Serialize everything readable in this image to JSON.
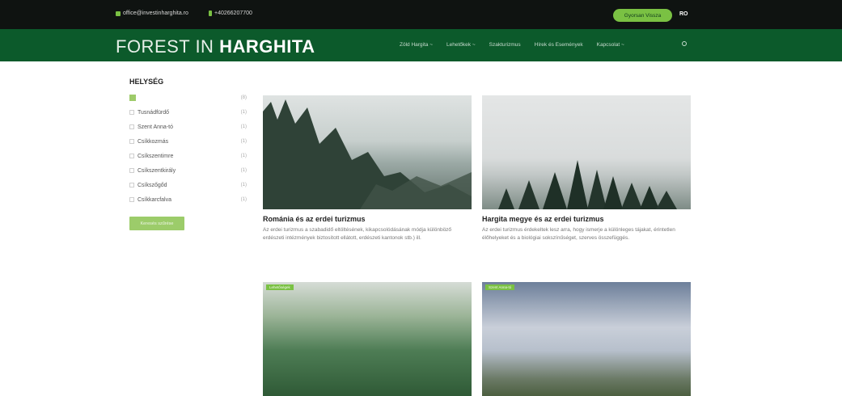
{
  "topbar": {
    "email": "office@investinharghita.ro",
    "phone": "+40266207700",
    "cta_label": "Gyorsan Vissza",
    "lang": "RO"
  },
  "nav": {
    "logo_part1": "FOREST IN ",
    "logo_part2": "HARGHITA",
    "items": [
      "Zöld Hargita ~",
      "Lehetőkek ~",
      "Szakturizmus",
      "Hírek és Események",
      "Kapcsolat ~"
    ],
    "search_icon": "search-icon"
  },
  "sidebar": {
    "title": "HELYSÉG",
    "all_count": "(8)",
    "filters": [
      {
        "label": "Tusnádfürdő",
        "count": "(1)"
      },
      {
        "label": "Szent Anna-tó",
        "count": "(1)"
      },
      {
        "label": "Csíkkozmás",
        "count": "(1)"
      },
      {
        "label": "Csíkszentimre",
        "count": "(1)"
      },
      {
        "label": "Csíkszentkirály",
        "count": "(1)"
      },
      {
        "label": "Csíkszőgőd",
        "count": "(1)"
      },
      {
        "label": "Csíkkarcfalva",
        "count": "(1)"
      }
    ],
    "button_label": "Keresés szűrése"
  },
  "cards": [
    {
      "title": "Románia és az erdei turizmus",
      "text": "Az erdei turizmus a szabadidő eltöltésének, kikapcsolódásának módja különböző erdészeti intézmények biztosított ellátott, erdészeti kantonok stb.) ill."
    },
    {
      "title": "Hargita megye és az erdei turizmus",
      "text": "Az erdei turizmus érdekeltek lesz arra, hogy ismerje a különleges tájakat, érintetlen élőhelyeket és a biológiai sokszínűséget, szerves összefüggés."
    },
    {
      "tag": "Lehetőségek",
      "title": "",
      "text": ""
    },
    {
      "tag": "Szent Anna-tó",
      "title": "",
      "text": ""
    }
  ],
  "colors": {
    "topbar": "#0f1311",
    "nav": "#0c5a2b",
    "accent": "#7ac143"
  }
}
